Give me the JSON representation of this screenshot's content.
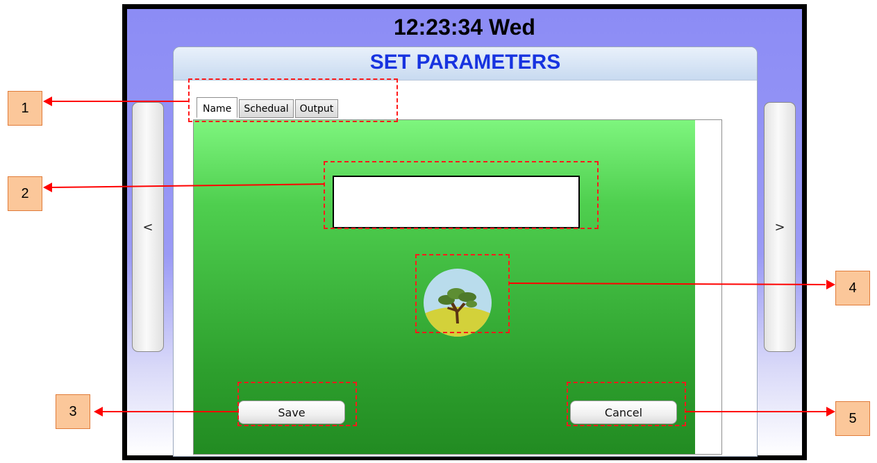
{
  "device": {
    "clock": "12:23:34 Wed",
    "prev_label": "<",
    "next_label": ">"
  },
  "dialog": {
    "title": "SET PARAMETERS",
    "tabs": [
      {
        "label": "Name",
        "active": true
      },
      {
        "label": "Schedual",
        "active": false
      },
      {
        "label": "Output",
        "active": false
      }
    ],
    "name_input": {
      "value": "",
      "placeholder": ""
    },
    "image_icon": "tree-landscape-icon",
    "save_label": "Save",
    "cancel_label": "Cancel"
  },
  "annotations": [
    {
      "label": "1"
    },
    {
      "label": "2"
    },
    {
      "label": "3"
    },
    {
      "label": "4"
    },
    {
      "label": "5"
    }
  ],
  "colors": {
    "title_text": "#1733e0",
    "screen_bg": "#8c8cf5",
    "panel_green_top": "#7ef57e",
    "panel_green_bottom": "#228b22",
    "annotation_red": "#ff0000",
    "callout_fill": "#fbc79a"
  }
}
